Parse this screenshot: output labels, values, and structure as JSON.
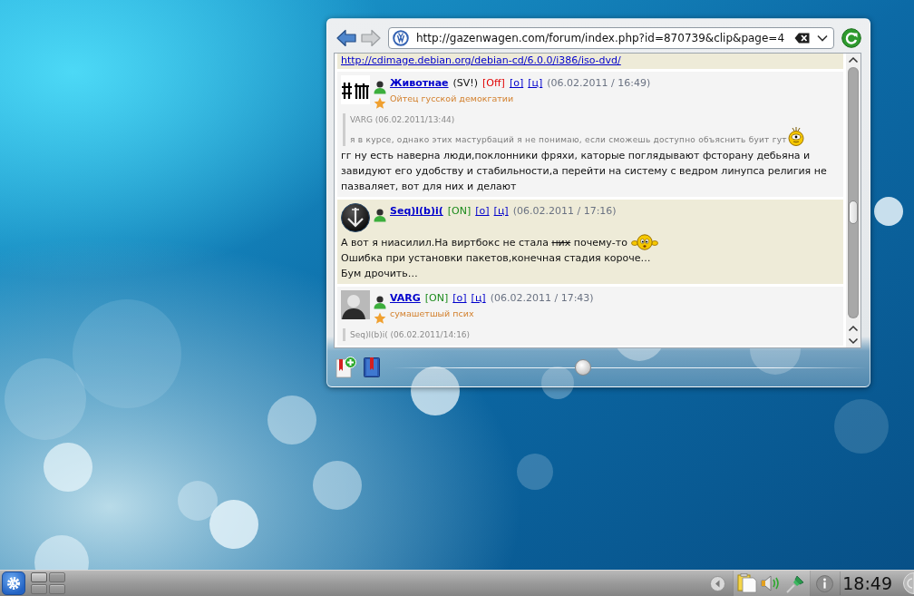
{
  "widget": {
    "url": "http://gazenwagen.com/forum/index.php?id=870739&clip&page=4",
    "zoom": {
      "level": 0.4
    }
  },
  "page": {
    "previous_post_tail": {
      "link": "http://cdimage.debian.org/debian-cd/6.0.0/i386/iso-dvd/",
      "highlighted": true
    },
    "posts": [
      {
        "avatar": {
          "kind": "hash"
        },
        "username": "Животнае",
        "tag": "(SV!)",
        "status": "[Off]",
        "online": false,
        "links": [
          "[о]",
          "[ц]"
        ],
        "date": "(06.02.2011 / 16:49)",
        "rank": "Ойтец гусской демокгатии",
        "highlighted": false,
        "quote": {
          "header": "VARG (06.02.2011/13:44)",
          "lines": [
            {
              "parts": [
                {
                  "text": "я в курсе, однако этих мастурбаций я не понимаю, если сможешь доступно объяснить буит гут",
                  "struck": false
                }
              ],
              "emoticon": true
            }
          ]
        },
        "body": [
          {
            "parts": [
              {
                "text": "гг ну есть наверна люди,поклонники фряхи, каторые поглядывают фсторану дебьяна и завидуют его удобству и стабильности,а перейти на систему с ведром линупса религия не пазваляет, вот для них и делают",
                "struck": false
              }
            ],
            "emoticon": false
          }
        ]
      },
      {
        "avatar": {
          "kind": "emblem"
        },
        "username": "Seq)l(b)i(",
        "status": "[ON]",
        "online": true,
        "links": [
          "[о]",
          "[ц]"
        ],
        "date": "(06.02.2011 / 17:16)",
        "highlighted": true,
        "body": [
          {
            "parts": [
              {
                "text": "А вот я ниасилил.На виртбокс не стала ",
                "struck": false
              },
              {
                "text": "них",
                "struck": true
              },
              {
                "text": " почему-то",
                "struck": false
              }
            ],
            "emoticon": true
          },
          {
            "parts": [
              {
                "text": "Ошибка при установки пакетов,конечная стадия короче…",
                "struck": false
              }
            ],
            "emoticon": false
          },
          {
            "parts": [
              {
                "text": "Бум дрочить…",
                "struck": false
              }
            ],
            "emoticon": false
          }
        ]
      },
      {
        "avatar": {
          "kind": "photo"
        },
        "username": "VARG",
        "status": "[ON]",
        "online": true,
        "links": [
          "[о]",
          "[ц]"
        ],
        "date": "(06.02.2011 / 17:43)",
        "rank": "сумашетшый псих",
        "highlighted": false,
        "quote": {
          "header": "Seq)l(b)i( (06.02.2011/14:16)"
        }
      }
    ]
  },
  "taskbar": {
    "desktops": [
      {
        "selected": true
      },
      {
        "selected": false
      },
      {
        "selected": false
      },
      {
        "selected": false
      }
    ],
    "clock": "18:49"
  }
}
